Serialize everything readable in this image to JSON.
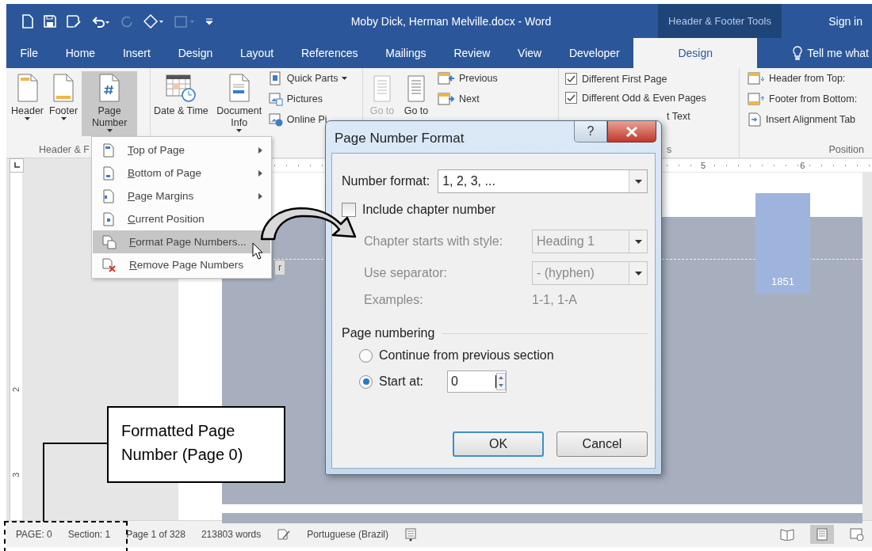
{
  "title_bar": {
    "title": "Moby Dick, Herman Melville.docx  -  Word",
    "context_tools": "Header & Footer Tools",
    "sign_in": "Sign in"
  },
  "tabs": [
    {
      "label": "File",
      "selected": false
    },
    {
      "label": "Home",
      "selected": false
    },
    {
      "label": "Insert",
      "selected": false
    },
    {
      "label": "Design",
      "selected": false
    },
    {
      "label": "Layout",
      "selected": false
    },
    {
      "label": "References",
      "selected": false
    },
    {
      "label": "Mailings",
      "selected": false
    },
    {
      "label": "Review",
      "selected": false
    },
    {
      "label": "View",
      "selected": false
    },
    {
      "label": "Developer",
      "selected": false
    },
    {
      "label": "Design",
      "selected": true
    }
  ],
  "tell_me": "Tell me what",
  "ribbon": {
    "groups": [
      {
        "label": "Header & F",
        "items": [
          {
            "kind": "large",
            "label": "Header",
            "dropdown": true,
            "pressed": false,
            "disabled": false
          },
          {
            "kind": "large",
            "label": "Footer",
            "dropdown": true,
            "pressed": false,
            "disabled": false
          },
          {
            "kind": "large",
            "label": "Page Number",
            "dropdown": true,
            "pressed": true,
            "disabled": false
          }
        ]
      },
      {
        "items": [
          {
            "kind": "large",
            "label": "Date & Time",
            "dropdown": false,
            "pressed": false,
            "disabled": false
          },
          {
            "kind": "large",
            "label": "Document Info",
            "dropdown": true,
            "pressed": false,
            "disabled": false
          },
          {
            "kind": "small-column",
            "items": [
              {
                "label": "Quick Parts",
                "dropdown": true
              },
              {
                "label": "Pictures",
                "dropdown": false
              },
              {
                "label": "Online Pi",
                "dropdown": false
              }
            ]
          }
        ]
      },
      {
        "items": [
          {
            "kind": "large",
            "label": "Go to",
            "dropdown": false,
            "pressed": false,
            "disabled": true
          },
          {
            "kind": "large",
            "label": "Go to",
            "dropdown": false,
            "pressed": false,
            "disabled": false
          },
          {
            "kind": "small-column",
            "items": [
              {
                "label": "Previous",
                "dropdown": false
              },
              {
                "label": "Next",
                "dropdown": false
              }
            ]
          }
        ]
      },
      {
        "label": "s",
        "items": [
          {
            "kind": "checkbox",
            "label": "Different First Page",
            "checked": true
          },
          {
            "kind": "checkbox",
            "label": "Different Odd & Even Pages",
            "checked": true
          },
          {
            "kind": "cut-text",
            "label": "t Text"
          }
        ]
      },
      {
        "label": "Position",
        "items": [
          {
            "kind": "small-column",
            "items": [
              {
                "label": "Header from Top:",
                "dropdown": false
              },
              {
                "label": "Footer from Bottom:",
                "dropdown": false
              },
              {
                "label": "Insert Alignment Tab",
                "dropdown": false
              }
            ]
          }
        ]
      }
    ]
  },
  "document": {
    "ruler_numbers": [
      "5",
      "6"
    ],
    "vertical_ruler_numbers": [
      "2",
      "3"
    ],
    "header_tag": "r",
    "block_text": "1851"
  },
  "page_number_menu": {
    "items": [
      {
        "label": "Top of Page",
        "submenu": true,
        "selected": false
      },
      {
        "label": "Bottom of Page",
        "submenu": true,
        "selected": false
      },
      {
        "label": "Page Margins",
        "submenu": true,
        "selected": false
      },
      {
        "label": "Current Position",
        "submenu": false,
        "selected": false
      },
      {
        "label": "Format Page Numbers...",
        "submenu": false,
        "selected": true
      },
      {
        "label": "Remove Page Numbers",
        "submenu": false,
        "selected": false
      }
    ]
  },
  "dialog": {
    "title": "Page Number Format",
    "help": "?",
    "number_format": {
      "label": "Number format:",
      "value": "1, 2, 3, ..."
    },
    "include_chapter": {
      "label": "Include chapter number",
      "checked": false
    },
    "chapter_style": {
      "label": "Chapter starts with style:",
      "value": "Heading 1",
      "disabled": true
    },
    "separator": {
      "label": "Use separator:",
      "value": "-  (hyphen)",
      "disabled": true
    },
    "examples": {
      "label": "Examples:",
      "value": "1-1, 1-A",
      "disabled": true
    },
    "page_numbering": {
      "title": "Page numbering",
      "options": [
        {
          "label": "Continue from previous section",
          "selected": false
        },
        {
          "label": "Start at:",
          "selected": true,
          "value": "0"
        }
      ]
    },
    "buttons": [
      {
        "label": "OK",
        "default": true
      },
      {
        "label": "Cancel",
        "default": false
      }
    ]
  },
  "status_bar": {
    "items": [
      {
        "kind": "text",
        "text": "PAGE: 0"
      },
      {
        "kind": "text",
        "text": "Section: 1"
      },
      {
        "kind": "text",
        "text": "Page 1 of 328"
      },
      {
        "kind": "text",
        "text": "213803 words"
      },
      {
        "kind": "icon"
      },
      {
        "kind": "text",
        "text": "Portuguese (Brazil)"
      },
      {
        "kind": "icon"
      }
    ],
    "views": [
      {
        "selected": false
      },
      {
        "selected": true
      },
      {
        "selected": false
      }
    ]
  },
  "callout": {
    "text": "Formatted Page Number (Page 0)"
  }
}
